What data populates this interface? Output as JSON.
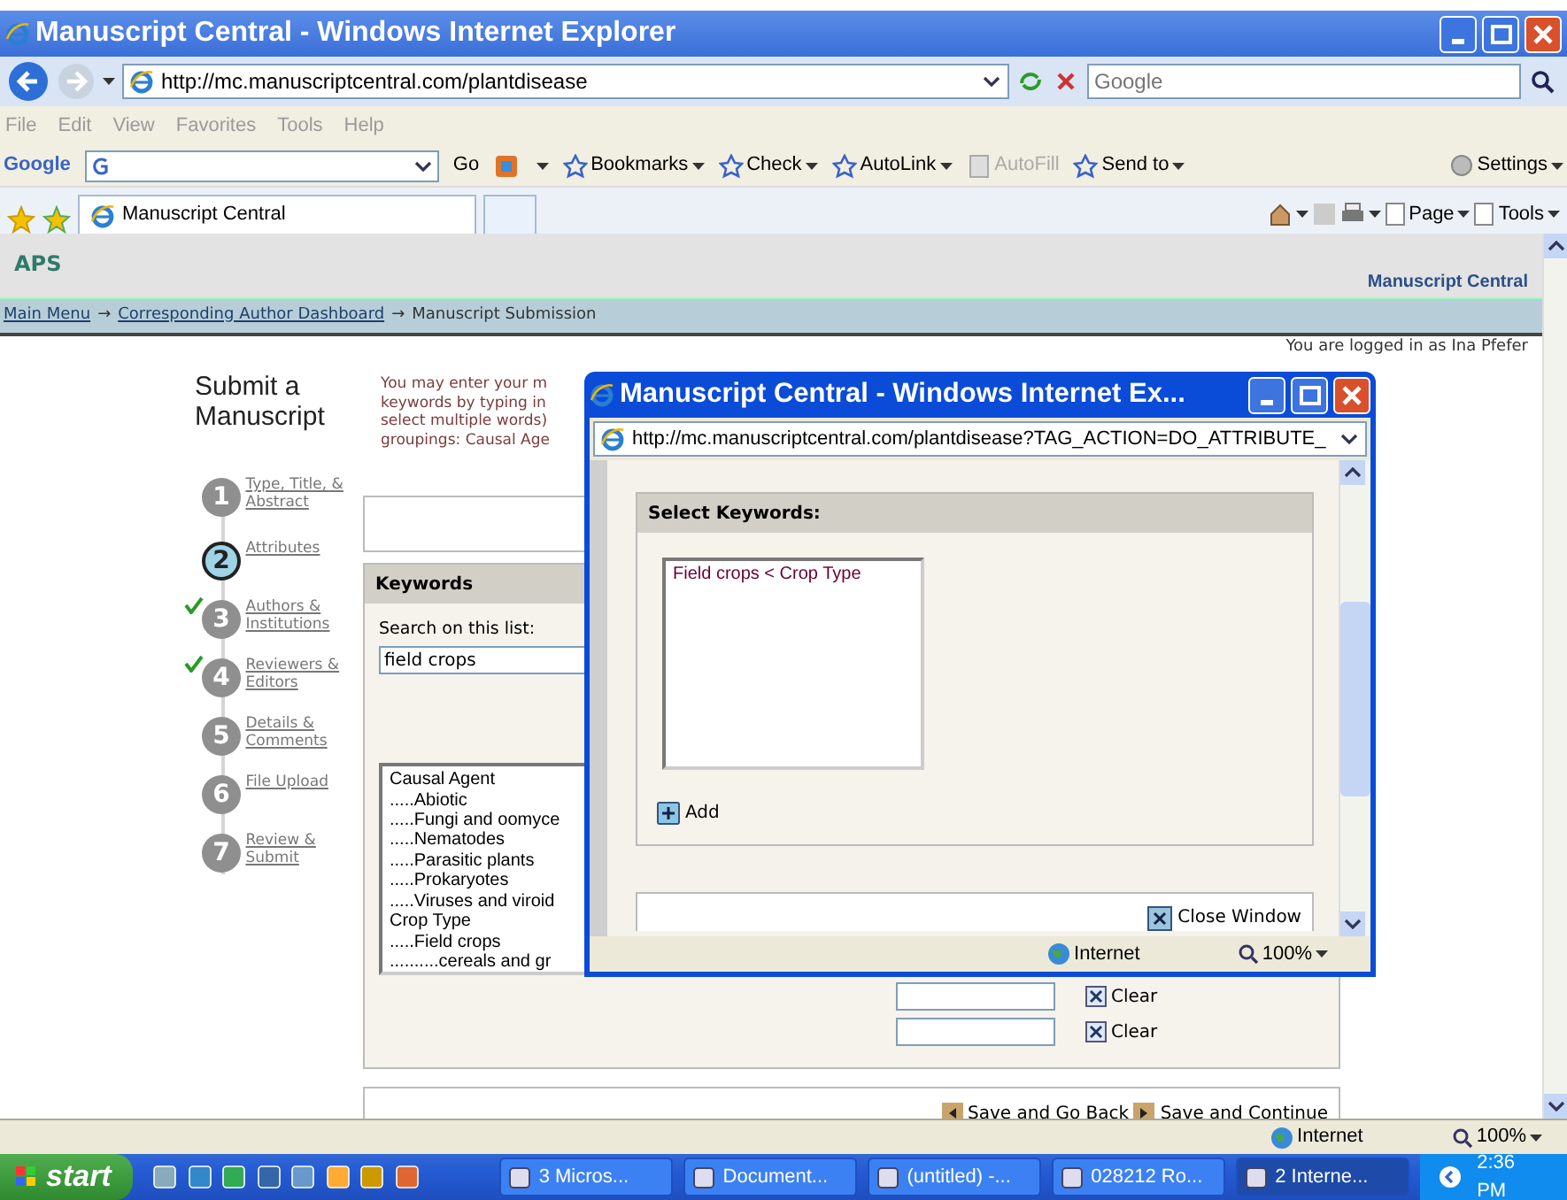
{
  "browser": {
    "title": "Manuscript Central - Windows Internet Explorer",
    "address": "http://mc.manuscriptcentral.com/plantdisease",
    "search_placeholder": "Google",
    "menu": [
      "File",
      "Edit",
      "View",
      "Favorites",
      "Tools",
      "Help"
    ],
    "google_toolbar": {
      "logo": "Google",
      "go": "Go",
      "items": [
        {
          "label": "Bookmarks",
          "kind": "dropdown",
          "disabled": false
        },
        {
          "label": "Check",
          "kind": "dropdown",
          "disabled": false
        },
        {
          "label": "AutoLink",
          "kind": "dropdown",
          "disabled": false
        },
        {
          "label": "AutoFill",
          "kind": "plain",
          "disabled": true
        },
        {
          "label": "Send to",
          "kind": "dropdown",
          "disabled": false
        }
      ],
      "settings": "Settings"
    },
    "tabs": [
      {
        "label": "Manuscript Central",
        "selected": true
      }
    ],
    "commands": [
      "Page",
      "Tools"
    ]
  },
  "page": {
    "logo": "APS",
    "brand": "Manuscript Central",
    "separator": "→",
    "breadcrumb": [
      {
        "label": "Main Menu",
        "link": true
      },
      {
        "label": "Corresponding Author Dashboard",
        "link": true
      },
      {
        "label": "Manuscript Submission",
        "link": false
      }
    ],
    "logged_in": "You are logged in as Ina Pfefer",
    "heading": "Submit a Manuscript",
    "steps": [
      {
        "number": "1",
        "label": "Type, Title, & Abstract",
        "checked": false,
        "selected": false
      },
      {
        "number": "2",
        "label": "Attributes",
        "checked": false,
        "selected": true
      },
      {
        "number": "3",
        "label": "Authors & Institutions",
        "checked": true,
        "selected": false
      },
      {
        "number": "4",
        "label": "Reviewers & Editors",
        "checked": true,
        "selected": false
      },
      {
        "number": "5",
        "label": "Details & Comments",
        "checked": false,
        "selected": false
      },
      {
        "number": "6",
        "label": "File Upload",
        "checked": false,
        "selected": false
      },
      {
        "number": "7",
        "label": "Review & Submit",
        "checked": false,
        "selected": false
      }
    ],
    "intro": [
      "You may enter your m",
      "keywords by typing in",
      "select multiple words)",
      "groupings: Causal Age"
    ],
    "keywords": {
      "title": "Keywords",
      "search_label": "Search on this list:",
      "search_value": "field crops",
      "list": [
        {
          "label": "Causal Agent",
          "children": [
            {
              "label": ".....Abiotic"
            },
            {
              "label": ".....Fungi and oomyce"
            },
            {
              "label": ".....Nematodes"
            },
            {
              "label": ".....Parasitic plants"
            },
            {
              "label": ".....Prokaryotes"
            },
            {
              "label": ".....Viruses and viroid"
            }
          ]
        },
        {
          "label": "Crop Type",
          "children": [
            {
              "label": ".....Field crops",
              "children": [
                {
                  "label": "..........cereals and gr"
                }
              ]
            }
          ]
        }
      ],
      "clear_buttons": [
        "Clear",
        "Clear"
      ]
    },
    "buttons": [
      "Save and Go Back",
      "Save and Continue"
    ]
  },
  "popup": {
    "title": "Manuscript Central - Windows Internet Ex...",
    "address": "http://mc.manuscriptcentral.com/plantdisease?TAG_ACTION=DO_ATTRIBUTE_",
    "section": "Select Keywords:",
    "selected_keywords": [
      "Field crops < Crop Type"
    ],
    "add": "Add",
    "close": "Close Window",
    "zone": "Internet",
    "zoom": "100%"
  },
  "status_bar": {
    "zone": "Internet",
    "zoom": "100%"
  },
  "taskbar": {
    "start": "start",
    "tasks": [
      {
        "label": "3 Micros...",
        "selected": false
      },
      {
        "label": "Document...",
        "selected": false
      },
      {
        "label": "(untitled) -...",
        "selected": false
      },
      {
        "label": "028212 Ro...",
        "selected": false
      },
      {
        "label": "2 Interne...",
        "selected": true
      }
    ],
    "clock": "2:36 PM"
  }
}
